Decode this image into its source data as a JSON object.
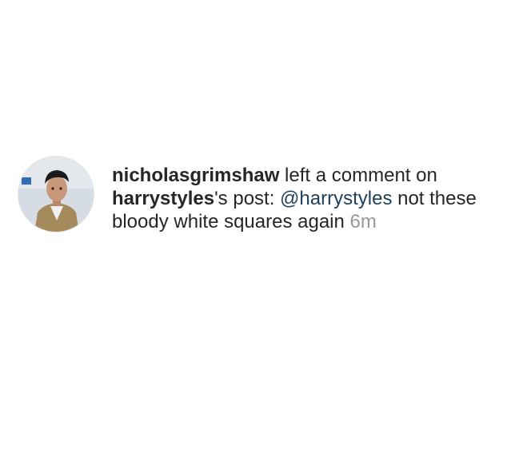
{
  "notification": {
    "actor": "nicholasgrimshaw",
    "action_prefix": " left a comment on ",
    "post_owner": "harrystyles",
    "post_suffix": "'s post: ",
    "mention": "@harrystyles",
    "comment_text": " not these bloody white squares again ",
    "timestamp": "6m"
  },
  "avatar": {
    "icon": "profile-photo"
  }
}
